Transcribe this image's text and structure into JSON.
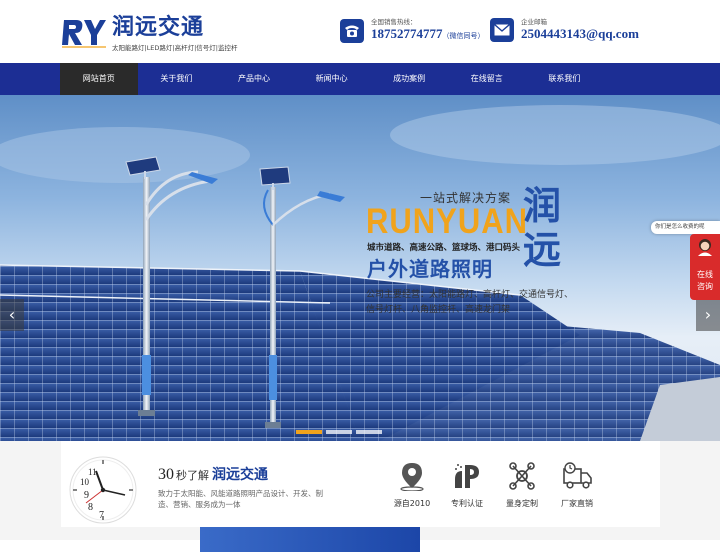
{
  "header": {
    "logo_text": "润远交通",
    "logo_tagline": "太阳能路灯|LED路灯|高杆灯|信号灯|监控杆",
    "hotline_label": "全国销售热线：",
    "hotline_number": "18752774777",
    "hotline_note": "（微信同号）",
    "email_label": "企业邮箱",
    "email_value": "2504443143@qq.com"
  },
  "nav": {
    "items": [
      "网站首页",
      "关于我们",
      "产品中心",
      "新闻中心",
      "成功案例",
      "在线留言",
      "联系我们"
    ],
    "active_index": 0
  },
  "banner": {
    "tagline": "一站式解决方案",
    "brand_en": "RUNYUAN",
    "brand_cn_1": "润",
    "brand_cn_2": "远",
    "services": "城市道路、高速公路、篮球场、港口码头",
    "headline": "户外道路照明",
    "scope_line1": "公司主要经营：太阳能路灯、高杆灯、交通信号灯、",
    "scope_line2": "信号灯杆、八角监控杆、高速龙门架",
    "prev_arrow": "‹",
    "next_arrow": "›",
    "slides_count": 3,
    "active_slide": 0,
    "accent_color": "#f0a31c"
  },
  "float_widget": {
    "tip": "你们是怎么收费的呢",
    "chat_line1": "在线",
    "chat_line2": "咨询"
  },
  "about": {
    "clock_numbers": [
      "9",
      "8",
      "7",
      "10",
      "11"
    ],
    "prefix_number": "30",
    "prefix_text": "秒了解",
    "brand": "润远交通",
    "description": "致力于太阳能、风能道路照明产品设计、开发、制造、营销、服务成为一体"
  },
  "features": [
    {
      "label": "源自2010",
      "icon": "map-pin-icon"
    },
    {
      "label": "专利认证",
      "icon": "patent-icon"
    },
    {
      "label": "量身定制",
      "icon": "network-icon"
    },
    {
      "label": "厂家直销",
      "icon": "delivery-truck-icon"
    }
  ],
  "colors": {
    "brand_blue": "#1b3f99",
    "nav_bg": "#1c2e94",
    "nav_active": "#2a2a2a",
    "float_red": "#d92b2b"
  }
}
